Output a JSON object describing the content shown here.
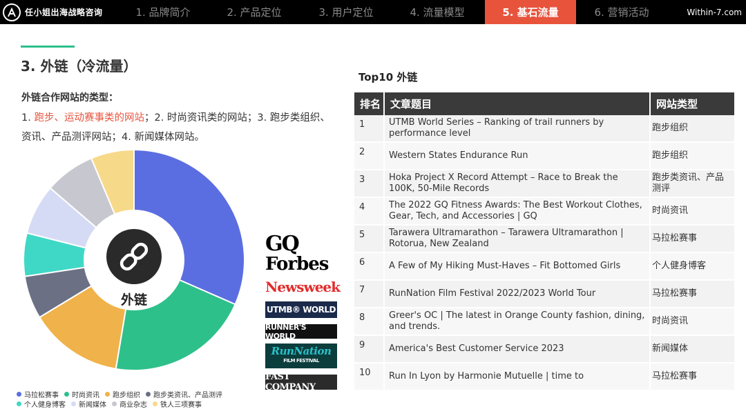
{
  "header": {
    "brand": "任小姐出海战略咨询",
    "tabs": [
      {
        "label": "1. 品牌简介"
      },
      {
        "label": "2. 产品定位"
      },
      {
        "label": "3. 用户定位"
      },
      {
        "label": "4. 流量模型"
      },
      {
        "label": "5. 基石流量",
        "active": true
      },
      {
        "label": "6. 营销活动"
      }
    ],
    "site": "Within-7.com",
    "accent_color": "#e8533c"
  },
  "section": {
    "title": "3. 外链（冷流量）",
    "types_heading": "外链合作网站的类型：",
    "types_prefix": "1. ",
    "types_highlight": "跑步、运动赛事类的网站",
    "types_rest": "；2. 时尚资讯类的网站；3. 跑步类组织、资讯、产品测评网站；4. 新闻媒体网站。"
  },
  "chart_data": {
    "type": "pie",
    "center_label": "外链",
    "center_icon": "link-icon",
    "slices": [
      {
        "name": "马拉松赛事",
        "value": 30,
        "color": "#5b6ee1"
      },
      {
        "name": "时尚资讯",
        "value": 20,
        "color": "#2ec08b"
      },
      {
        "name": "跑步组织",
        "value": 13,
        "color": "#f0b24a"
      },
      {
        "name": "跑步类资讯、产品测评",
        "value": 6,
        "color": "#6b7085"
      },
      {
        "name": "个人健身博客",
        "value": 6,
        "color": "#3fd8c6"
      },
      {
        "name": "新闻媒体",
        "value": 7,
        "color": "#d6dbf5"
      },
      {
        "name": "商业杂志",
        "value": 7,
        "color": "#c7c8cf"
      },
      {
        "name": "铁人三项赛事",
        "value": 6,
        "color": "#f7d98a"
      }
    ],
    "legend_placement": "bottom"
  },
  "logos": {
    "gq": "GQ",
    "forbes": "Forbes",
    "newsweek": "Newsweek",
    "utmb": "UTMB® WORLD",
    "runners": "RUNNER'S WORLD",
    "runnation": "RunNation",
    "runnation_sub": "FILM FESTIVAL",
    "fastco": "FAST COMPANY"
  },
  "table": {
    "caption": "Top10 外链",
    "headers": [
      "排名",
      "文章题目",
      "网站类型"
    ],
    "rows": [
      {
        "rank": "1",
        "title": "UTMB World Series – Ranking of trail runners by performance level",
        "type": "跑步组织"
      },
      {
        "rank": "2",
        "title": "Western States Endurance Run",
        "type": "跑步组织"
      },
      {
        "rank": "3",
        "title": "Hoka Project X Record Attempt – Race to Break the 100K, 50-Mile Records",
        "type": "跑步类资讯、产品测评"
      },
      {
        "rank": "4",
        "title": "The 2022 GQ Fitness Awards: The Best Workout Clothes, Gear, Tech, and Accessories | GQ",
        "type": "时尚资讯"
      },
      {
        "rank": "5",
        "title": "Tarawera Ultramarathon – Tarawera Ultramarathon | Rotorua, New Zealand",
        "type": "马拉松赛事"
      },
      {
        "rank": "6",
        "title": "A Few of My Hiking Must-Haves – Fit Bottomed Girls",
        "type": "个人健身博客"
      },
      {
        "rank": "7",
        "title": "RunNation Film Festival 2022/2023 World Tour",
        "type": "马拉松赛事"
      },
      {
        "rank": "8",
        "title": "Greer's OC | The latest in Orange County fashion, dining, and trends.",
        "type": "时尚资讯"
      },
      {
        "rank": "9",
        "title": "America's Best Customer Service 2023",
        "type": "新闻媒体"
      },
      {
        "rank": "10",
        "title": "Run In Lyon by Harmonie Mutuelle | time to",
        "type": "马拉松赛事"
      }
    ]
  }
}
